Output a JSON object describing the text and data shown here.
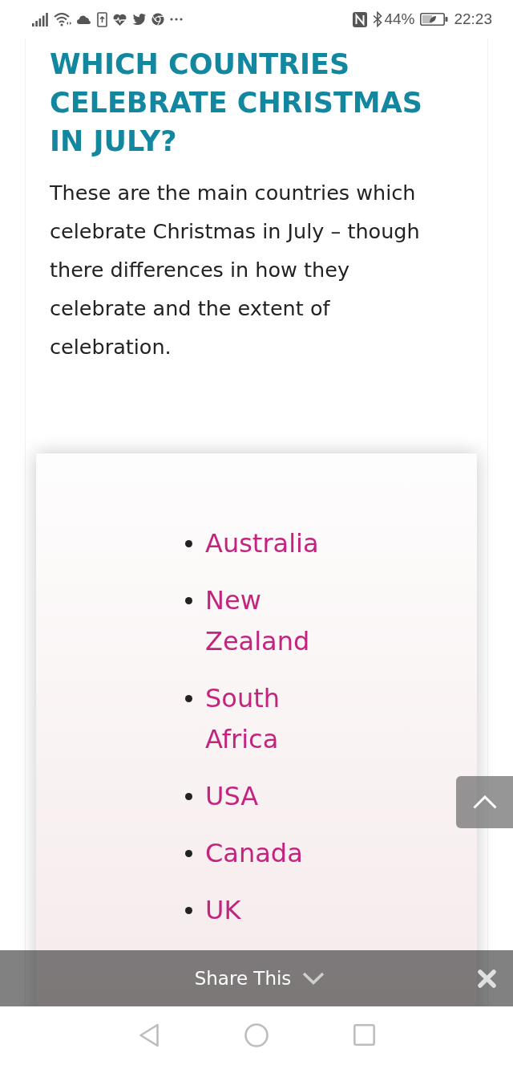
{
  "status_bar": {
    "battery": "44%",
    "time": "22:23"
  },
  "article": {
    "heading": "WHICH COUNTRIES CELEBRATE CHRISTMAS IN JULY?",
    "paragraph": "These are the main countries which celebrate Christmas in July – though there differences in how they celebrate and the extent of celebration."
  },
  "country_list": [
    "Australia",
    "New Zealand",
    "South Africa",
    "USA",
    "Canada",
    "UK"
  ],
  "share_bar": {
    "label": "Share This"
  }
}
